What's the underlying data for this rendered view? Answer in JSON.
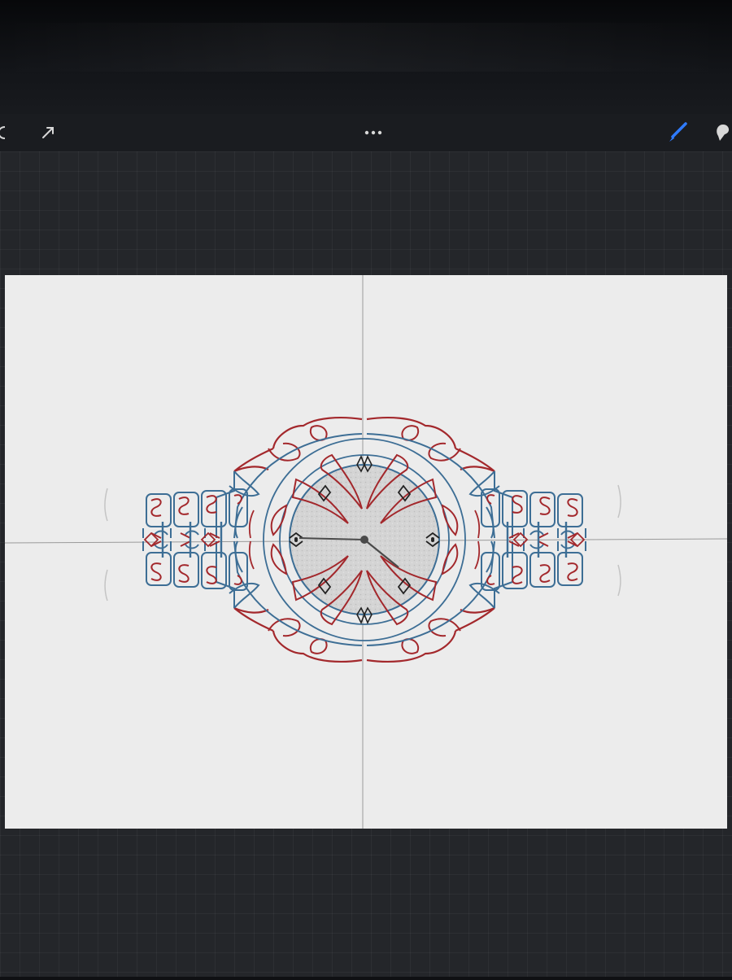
{
  "toolbar": {
    "left_icons": [
      "undo-icon",
      "selection-arrow-icon"
    ],
    "center_icon": "more-options-icon",
    "right_icons": [
      "brush-icon",
      "smudge-icon"
    ],
    "accent_color": "#2f7bff"
  },
  "canvas": {
    "background": "#ececec",
    "guide_color": "#9a9a9a",
    "drawing": {
      "subject": "wristwatch",
      "symmetry": "quadrant",
      "stroke_colors": {
        "red": "#a3282c",
        "blue": "#3d6e95",
        "black": "#222222"
      },
      "dial_fill": "#cfcfcf"
    }
  }
}
